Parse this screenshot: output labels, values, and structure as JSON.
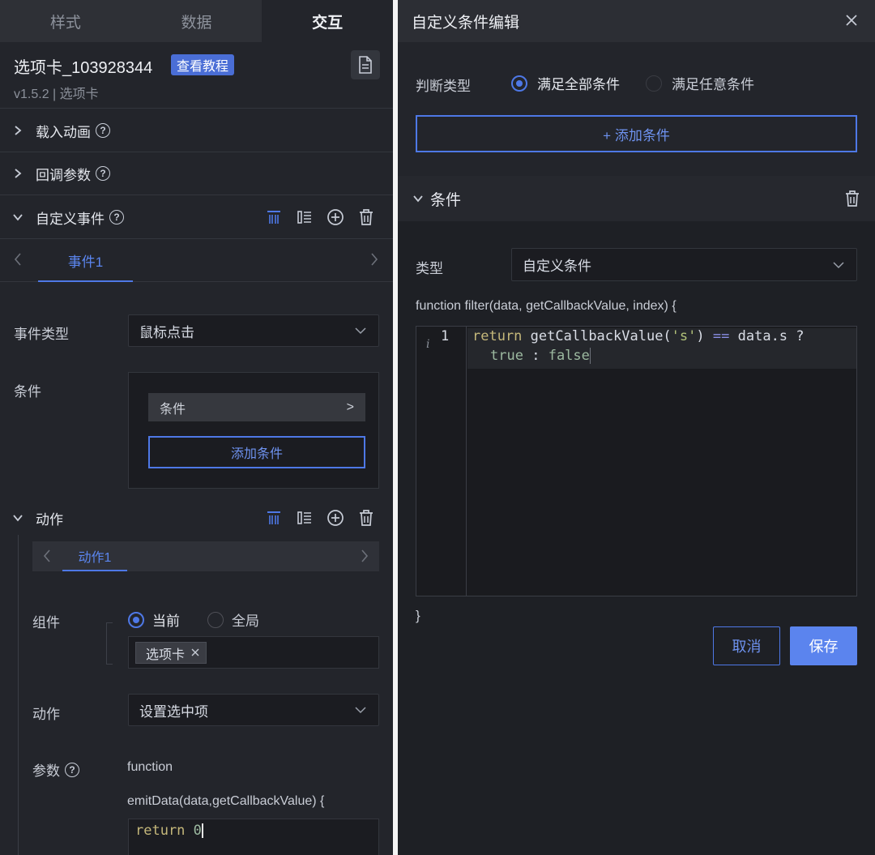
{
  "left_panel": {
    "tabs": [
      "样式",
      "数据",
      "交互"
    ],
    "active_tab": "交互",
    "component": {
      "name": "选项卡_103928344",
      "tutorial_label": "查看教程",
      "version": "v1.5.2 | 选项卡"
    },
    "sections": {
      "load_animation": "载入动画",
      "callback_params": "回调参数",
      "custom_events": "自定义事件"
    },
    "event_tab": "事件1",
    "event_type_label": "事件类型",
    "event_type_value": "鼠标点击",
    "condition_label": "条件",
    "condition_item": "条件",
    "condition_item_arrow": ">",
    "add_condition": "添加条件",
    "action_section": "动作",
    "action_tab": "动作1",
    "component_label": "组件",
    "scope_options": [
      "当前",
      "全局"
    ],
    "selected_scope": "当前",
    "component_tag": "选项卡",
    "action_label": "动作",
    "action_value": "设置选中项",
    "params_label": "参数",
    "function_line1": "function",
    "function_line2": "emitData(data,getCallbackValue) {",
    "code_keyword": "return",
    "code_value": "0"
  },
  "right_panel": {
    "title": "自定义条件编辑",
    "judge_label": "判断类型",
    "judge_options": [
      "满足全部条件",
      "满足任意条件"
    ],
    "selected_judge": "满足全部条件",
    "add_condition": "+ 添加条件",
    "condition_section": "条件",
    "type_label": "类型",
    "type_value": "自定义条件",
    "function_signature": "function filter(data, getCallbackValue, index) {",
    "editor": {
      "line_number": "1",
      "info_marker": "i",
      "code_return": "return",
      "code_call": "getCallbackValue(",
      "code_string": "'s'",
      "code_close": ")",
      "code_op": "==",
      "code_rhs": "data.s ?",
      "code_true": "true",
      "code_colon": ":",
      "code_false": "false"
    },
    "closing_brace": "}",
    "cancel_label": "取消",
    "save_label": "保存"
  },
  "colors": {
    "accent": "#4e78e6",
    "panel_bg": "#23252b",
    "input_bg": "#1b1c21"
  }
}
